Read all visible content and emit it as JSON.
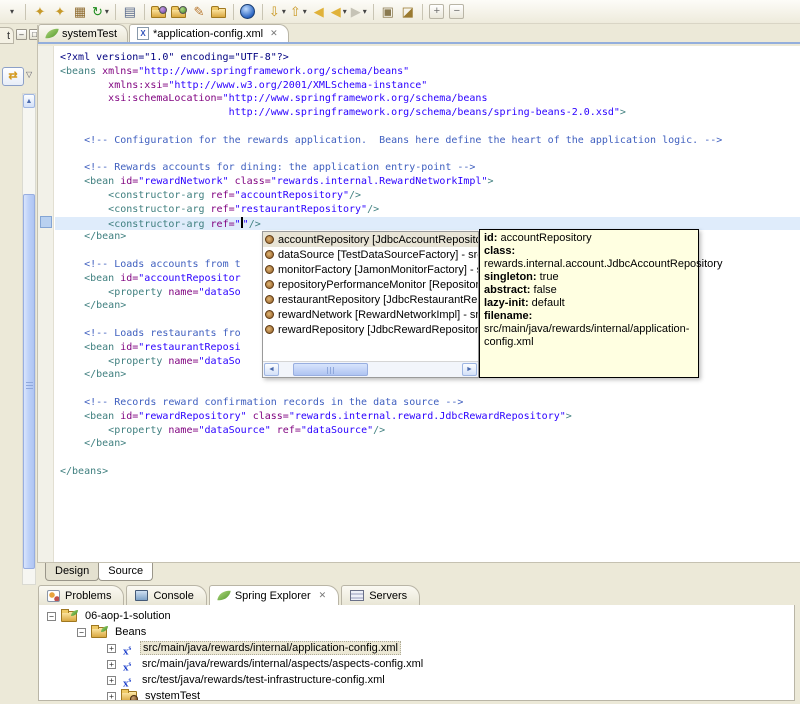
{
  "glyphs": {
    "caret": "▾",
    "chevron": "▽",
    "close": "✕",
    "minimize": "–",
    "restore": "□",
    "scroll_up": "▲",
    "scroll_left": "◄",
    "scroll_right": "►",
    "link": "⇄",
    "twisty_open": "−",
    "twisty_closed": "+",
    "xml_letter": "X",
    "spring_config_letter": "x",
    "spring_config_sup": "s"
  },
  "left_strip": {
    "clipped_tab_label": "t"
  },
  "toolbar": {
    "items": [
      {
        "name": "toolbar-overflow",
        "glyph": "",
        "caret": true
      },
      {
        "sep": true
      },
      {
        "name": "new-spring-project",
        "glyph": "✦",
        "color": "#C79A2A"
      },
      {
        "name": "new-spring-bean",
        "glyph": "✦",
        "color": "#C79A2A"
      },
      {
        "name": "new-package",
        "glyph": "▦",
        "color": "#8E6B2F"
      },
      {
        "name": "refresh",
        "glyph": "↻",
        "color": "#1E8C1E",
        "caret": true
      },
      {
        "sep": true
      },
      {
        "name": "show-properties",
        "glyph": "▤",
        "color": "#5A6B8C"
      },
      {
        "sep": true
      },
      {
        "name": "open-resource",
        "css": "icn-folder dot-purple"
      },
      {
        "name": "open-type",
        "css": "icn-folder dot-green"
      },
      {
        "name": "format-brush",
        "glyph": "✎",
        "color": "#B87830"
      },
      {
        "name": "open-folder",
        "css": "icn-folder"
      },
      {
        "sep": true
      },
      {
        "name": "web-browser",
        "css": "icn-globe"
      },
      {
        "sep": true
      },
      {
        "name": "import",
        "glyph": "⇩",
        "color": "#C89620",
        "caret": true
      },
      {
        "name": "export",
        "glyph": "⇧",
        "color": "#C89620",
        "caret": true
      },
      {
        "name": "last-edit-location",
        "glyph": "◀",
        "color": "#E0B23A"
      },
      {
        "name": "back",
        "glyph": "◀",
        "color": "#E0B23A",
        "caret": true
      },
      {
        "name": "forward",
        "glyph": "▶",
        "color": "#C6C3B6",
        "caret": true,
        "disabled": true
      },
      {
        "sep": true
      },
      {
        "name": "run-history",
        "glyph": "▣",
        "color": "#8A7A50"
      },
      {
        "name": "external-tools",
        "glyph": "◪",
        "color": "#9A7A30"
      },
      {
        "sep": true
      },
      {
        "name": "expand-all",
        "glyph": "+",
        "color": "#6F6F6F",
        "boxed": true
      },
      {
        "name": "collapse-all",
        "glyph": "−",
        "color": "#6F6F6F",
        "boxed": true
      }
    ]
  },
  "editor_tabs": [
    {
      "label": "systemTest",
      "icon": "spring-leaf",
      "active": false,
      "closable": false
    },
    {
      "label": "*application-config.xml",
      "icon": "xml-file",
      "active": true,
      "closable": true
    }
  ],
  "editor": {
    "colors": {
      "tag": "#3F7F7F",
      "attr": "#7F007F",
      "val": "#2A00FF",
      "comment": "#3F5FBF",
      "decl": "#000080",
      "current_line_bg": "#DFECFB"
    },
    "lines": [
      {
        "segs": [
          {
            "t": "<?xml version=\"1.0\" encoding=\"UTF-8\"?>",
            "c": "decl"
          }
        ]
      },
      {
        "segs": [
          {
            "t": "<beans ",
            "c": "tag"
          },
          {
            "t": "xmlns=",
            "c": "attr"
          },
          {
            "t": "\"http://www.springframework.org/schema/beans\"",
            "c": "val"
          }
        ]
      },
      {
        "segs": [
          {
            "t": "        ",
            "c": "pl"
          },
          {
            "t": "xmlns:xsi=",
            "c": "attr"
          },
          {
            "t": "\"http://www.w3.org/2001/XMLSchema-instance\"",
            "c": "val"
          }
        ]
      },
      {
        "segs": [
          {
            "t": "        ",
            "c": "pl"
          },
          {
            "t": "xsi:schemaLocation=",
            "c": "attr"
          },
          {
            "t": "\"http://www.springframework.org/schema/beans",
            "c": "val"
          }
        ]
      },
      {
        "segs": [
          {
            "t": "                            ",
            "c": "pl"
          },
          {
            "t": "http://www.springframework.org/schema/beans/spring-beans-2.0.xsd\"",
            "c": "val"
          },
          {
            "t": ">",
            "c": "tag"
          }
        ]
      },
      {
        "segs": []
      },
      {
        "segs": [
          {
            "t": "    ",
            "c": "pl"
          },
          {
            "t": "<!-- Configuration for the rewards application.  Beans here define the heart of the application logic. -->",
            "c": "com"
          }
        ]
      },
      {
        "segs": []
      },
      {
        "segs": [
          {
            "t": "    ",
            "c": "pl"
          },
          {
            "t": "<!-- Rewards accounts for dining: the application entry-point -->",
            "c": "com"
          }
        ]
      },
      {
        "segs": [
          {
            "t": "    ",
            "c": "pl"
          },
          {
            "t": "<bean ",
            "c": "tag"
          },
          {
            "t": "id=",
            "c": "attr"
          },
          {
            "t": "\"rewardNetwork\"",
            "c": "val"
          },
          {
            "t": " ",
            "c": "pl"
          },
          {
            "t": "class=",
            "c": "attr"
          },
          {
            "t": "\"rewards.internal.RewardNetworkImpl\"",
            "c": "val"
          },
          {
            "t": ">",
            "c": "tag"
          }
        ]
      },
      {
        "segs": [
          {
            "t": "        ",
            "c": "pl"
          },
          {
            "t": "<constructor-arg ",
            "c": "tag"
          },
          {
            "t": "ref=",
            "c": "attr"
          },
          {
            "t": "\"accountRepository\"",
            "c": "val"
          },
          {
            "t": "/>",
            "c": "tag"
          }
        ]
      },
      {
        "segs": [
          {
            "t": "        ",
            "c": "pl"
          },
          {
            "t": "<constructor-arg ",
            "c": "tag"
          },
          {
            "t": "ref=",
            "c": "attr"
          },
          {
            "t": "\"restaurantRepository\"",
            "c": "val"
          },
          {
            "t": "/>",
            "c": "tag"
          }
        ]
      },
      {
        "current": true,
        "segs": [
          {
            "t": "        ",
            "c": "pl"
          },
          {
            "t": "<constructor-arg ",
            "c": "tag"
          },
          {
            "t": "ref=",
            "c": "attr"
          },
          {
            "t": "\"",
            "c": "val"
          },
          {
            "c": "cursor"
          },
          {
            "t": "\"",
            "c": "val"
          },
          {
            "t": "/>",
            "c": "tag"
          }
        ]
      },
      {
        "segs": [
          {
            "t": "    ",
            "c": "pl"
          },
          {
            "t": "</bean>",
            "c": "tag"
          }
        ]
      },
      {
        "segs": []
      },
      {
        "segs": [
          {
            "t": "    ",
            "c": "pl"
          },
          {
            "t": "<!-- Loads accounts from t",
            "c": "com"
          }
        ]
      },
      {
        "segs": [
          {
            "t": "    ",
            "c": "pl"
          },
          {
            "t": "<bean ",
            "c": "tag"
          },
          {
            "t": "id=",
            "c": "attr"
          },
          {
            "t": "\"accountRepositor",
            "c": "val"
          }
        ]
      },
      {
        "segs": [
          {
            "t": "        ",
            "c": "pl"
          },
          {
            "t": "<property ",
            "c": "tag"
          },
          {
            "t": "name=",
            "c": "attr"
          },
          {
            "t": "\"dataSo",
            "c": "val"
          }
        ]
      },
      {
        "segs": [
          {
            "t": "    ",
            "c": "pl"
          },
          {
            "t": "</bean>",
            "c": "tag"
          }
        ]
      },
      {
        "segs": []
      },
      {
        "segs": [
          {
            "t": "    ",
            "c": "pl"
          },
          {
            "t": "<!-- Loads restaurants fro",
            "c": "com"
          }
        ]
      },
      {
        "segs": [
          {
            "t": "    ",
            "c": "pl"
          },
          {
            "t": "<bean ",
            "c": "tag"
          },
          {
            "t": "id=",
            "c": "attr"
          },
          {
            "t": "\"restaurantReposi",
            "c": "val"
          }
        ]
      },
      {
        "segs": [
          {
            "t": "        ",
            "c": "pl"
          },
          {
            "t": "<property ",
            "c": "tag"
          },
          {
            "t": "name=",
            "c": "attr"
          },
          {
            "t": "\"dataSo",
            "c": "val"
          }
        ]
      },
      {
        "segs": [
          {
            "t": "    ",
            "c": "pl"
          },
          {
            "t": "</bean>",
            "c": "tag"
          }
        ]
      },
      {
        "segs": []
      },
      {
        "segs": [
          {
            "t": "    ",
            "c": "pl"
          },
          {
            "t": "<!-- Records reward confirmation records in the data source -->",
            "c": "com"
          }
        ]
      },
      {
        "segs": [
          {
            "t": "    ",
            "c": "pl"
          },
          {
            "t": "<bean ",
            "c": "tag"
          },
          {
            "t": "id=",
            "c": "attr"
          },
          {
            "t": "\"rewardRepository\"",
            "c": "val"
          },
          {
            "t": " ",
            "c": "pl"
          },
          {
            "t": "class=",
            "c": "attr"
          },
          {
            "t": "\"rewards.internal.reward.JdbcRewardRepository\"",
            "c": "val"
          },
          {
            "t": ">",
            "c": "tag"
          }
        ]
      },
      {
        "segs": [
          {
            "t": "        ",
            "c": "pl"
          },
          {
            "t": "<property ",
            "c": "tag"
          },
          {
            "t": "name=",
            "c": "attr"
          },
          {
            "t": "\"dataSource\"",
            "c": "val"
          },
          {
            "t": " ",
            "c": "pl"
          },
          {
            "t": "ref=",
            "c": "attr"
          },
          {
            "t": "\"dataSource\"",
            "c": "val"
          },
          {
            "t": "/>",
            "c": "tag"
          }
        ]
      },
      {
        "segs": [
          {
            "t": "    ",
            "c": "pl"
          },
          {
            "t": "</bean>",
            "c": "tag"
          }
        ]
      },
      {
        "segs": []
      },
      {
        "segs": [
          {
            "t": "</beans>",
            "c": "tag"
          }
        ]
      }
    ]
  },
  "completion": {
    "items": [
      {
        "label": "accountRepository [JdbcAccountRepository] - src",
        "selected": true
      },
      {
        "label": "dataSource [TestDataSourceFactory] - src/test/ja",
        "selected": false
      },
      {
        "label": "monitorFactory [JamonMonitorFactory] - src/main",
        "selected": false
      },
      {
        "label": "repositoryPerformanceMonitor [RepositoryPerform",
        "selected": false
      },
      {
        "label": "restaurantRepository [JdbcRestaurantRepository]",
        "selected": false
      },
      {
        "label": "rewardNetwork [RewardNetworkImpl] - src/main/j",
        "selected": false
      },
      {
        "label": "rewardRepository [JdbcRewardRepository] - src/r",
        "selected": false
      }
    ]
  },
  "tooltip": {
    "rows": [
      {
        "label": "id:",
        "value": " accountRepository"
      },
      {
        "label": "class:",
        "value": ""
      },
      {
        "label": "",
        "value": " rewards.internal.account.JdbcAccountRepository"
      },
      {
        "label": "singleton:",
        "value": " true"
      },
      {
        "label": "abstract:",
        "value": " false"
      },
      {
        "label": "lazy-init:",
        "value": " default"
      },
      {
        "label": "filename:",
        "value": " src/main/java/rewards/internal/application-config.xml"
      }
    ]
  },
  "source_tabs": [
    {
      "label": "Design",
      "active": false
    },
    {
      "label": "Source",
      "active": true
    }
  ],
  "bottom_tabs": [
    {
      "label": "Problems",
      "icon": "problems",
      "active": false,
      "closable": false
    },
    {
      "label": "Console",
      "icon": "console",
      "active": false,
      "closable": false
    },
    {
      "label": "Spring Explorer",
      "icon": "spring-leaf",
      "active": true,
      "closable": true
    },
    {
      "label": "Servers",
      "icon": "servers",
      "active": false,
      "closable": false
    }
  ],
  "tree": {
    "nodes": [
      {
        "label": "06-aop-1-solution",
        "depth": 0,
        "twisty": "open",
        "icon": "spring-project",
        "selected": false
      },
      {
        "label": "Beans",
        "depth": 1,
        "twisty": "open",
        "icon": "beans-folder",
        "selected": false
      },
      {
        "label": "src/main/java/rewards/internal/application-config.xml",
        "depth": 2,
        "twisty": "closed",
        "icon": "spring-config",
        "selected": true
      },
      {
        "label": "src/main/java/rewards/internal/aspects/aspects-config.xml",
        "depth": 2,
        "twisty": "closed",
        "icon": "spring-config",
        "selected": false
      },
      {
        "label": "src/test/java/rewards/test-infrastructure-config.xml",
        "depth": 2,
        "twisty": "closed",
        "icon": "spring-config",
        "selected": false
      },
      {
        "label": "systemTest",
        "depth": 2,
        "twisty": "closed",
        "icon": "config-set",
        "selected": false
      }
    ]
  }
}
